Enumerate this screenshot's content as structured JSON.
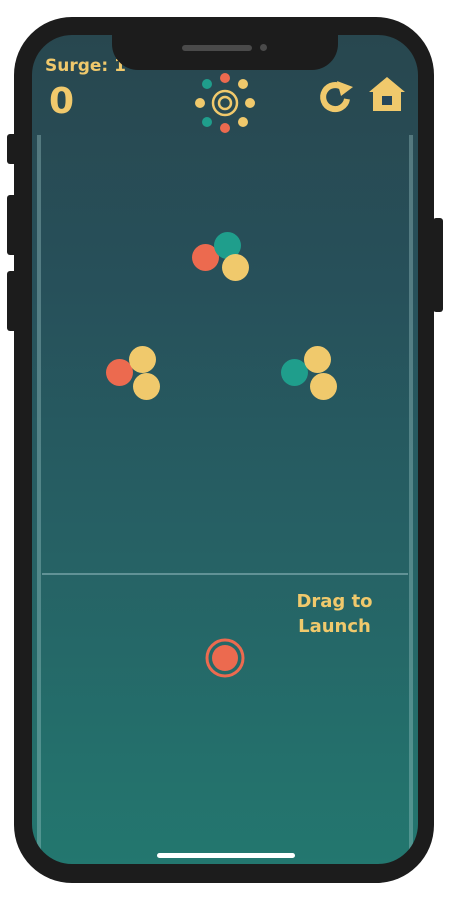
{
  "hud": {
    "surge_label": "Surge: 1",
    "score": "0",
    "restart_icon": "restart-icon",
    "home_icon": "home-icon"
  },
  "palette": {
    "coral": "#ec6a4f",
    "teal": "#1f9e8c",
    "yellow": "#f0c96c"
  },
  "clusters": [
    {
      "balls": [
        "coral",
        "teal",
        "yellow"
      ]
    },
    {
      "balls": [
        "coral",
        "yellow",
        "yellow"
      ]
    },
    {
      "balls": [
        "teal",
        "yellow",
        "yellow"
      ]
    }
  ],
  "launch_zone": {
    "hint": "Drag to\nLaunch",
    "launcher_color": "coral"
  }
}
